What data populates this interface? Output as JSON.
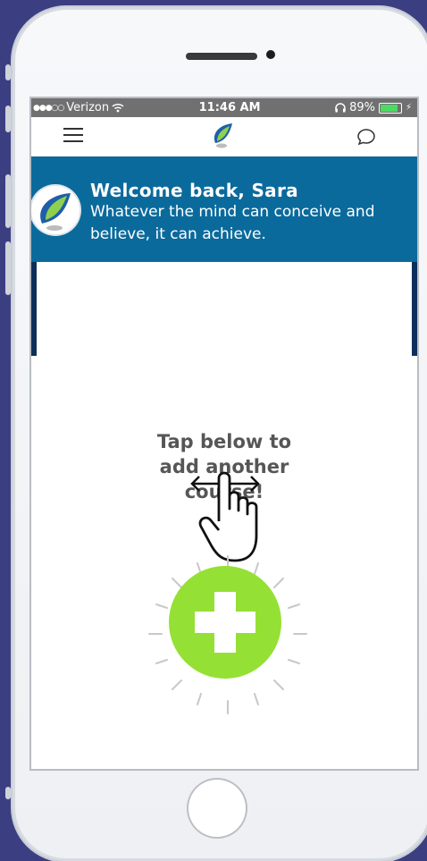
{
  "status_bar": {
    "signal": "●●●○○",
    "carrier": "Verizon",
    "time": "11:46 AM",
    "battery_percent": "89%"
  },
  "header": {
    "menu_icon": "hamburger-icon",
    "logo_icon": "leaf-logo-icon",
    "chat_icon": "chat-icon"
  },
  "banner": {
    "title": "Welcome back, Sara",
    "quote": "Whatever the mind can conceive and believe, it can achieve."
  },
  "main": {
    "prompt_line1": "Tap below to",
    "prompt_line2": "add another",
    "prompt_line3": "course!"
  },
  "colors": {
    "banner": "#0b6a9c",
    "add_button": "#95e034",
    "status_bar": "#707070"
  }
}
